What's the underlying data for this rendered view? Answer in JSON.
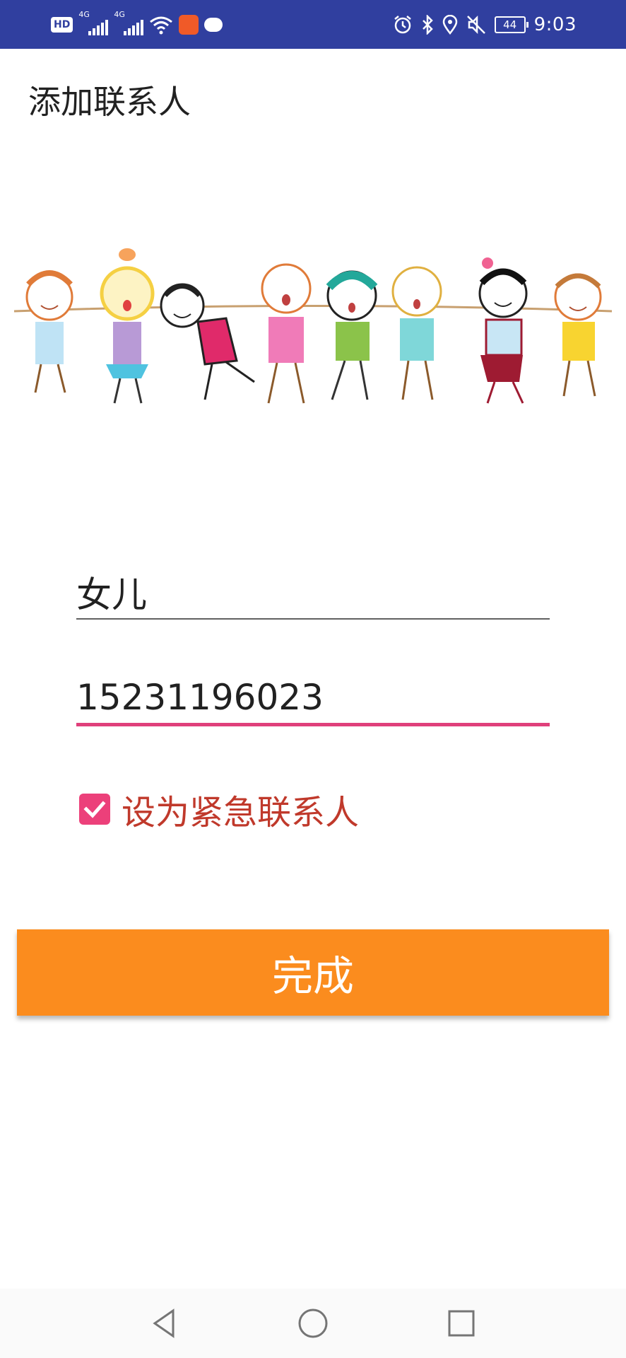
{
  "status_bar": {
    "hd_badge": "HD",
    "network_1": "4G",
    "network_2": "4G",
    "icons": [
      "hd-icon",
      "signal-icon",
      "signal-icon",
      "wifi-icon",
      "app-notification-icon",
      "chat-icon",
      "alarm-icon",
      "bluetooth-icon",
      "location-icon",
      "mute-icon",
      "battery-icon"
    ],
    "battery_level": "44",
    "time": "9:03",
    "background_color": "#303f9f"
  },
  "page": {
    "title": "添加联系人"
  },
  "form": {
    "name_value": "女儿",
    "phone_value": "15231196023",
    "emergency_checked": true,
    "emergency_label": "设为紧急联系人",
    "accent_color": "#e0407b",
    "label_color": "#c0392b"
  },
  "actions": {
    "done_label": "完成",
    "button_color": "#fb8c1e"
  },
  "nav": {
    "icons": [
      "back-triangle-icon",
      "home-circle-icon",
      "recents-square-icon"
    ]
  }
}
